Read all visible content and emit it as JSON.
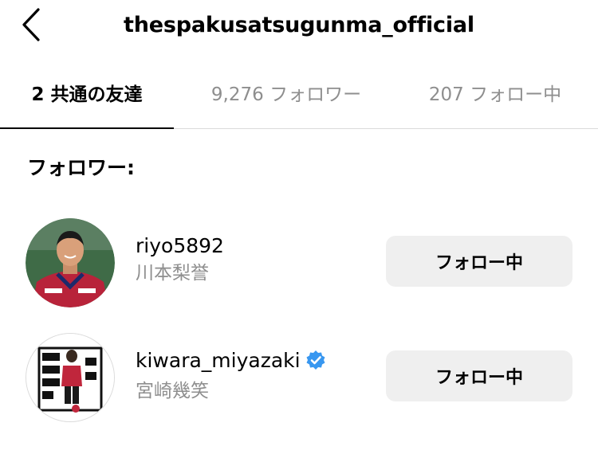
{
  "header": {
    "title": "thespakusatsugunma_official",
    "back_icon": "chevron-left-icon"
  },
  "tabs": [
    {
      "label": "2 共通の友達",
      "active": true
    },
    {
      "label": "9,276 フォロワー",
      "active": false
    },
    {
      "label": "207 フォロー中",
      "active": false
    }
  ],
  "section": {
    "label": "フォロワー:"
  },
  "users": [
    {
      "username": "riyo5892",
      "full_name": "川本梨誉",
      "verified": false,
      "button_label": "フォロー中"
    },
    {
      "username": "kiwara_miyazaki",
      "full_name": "宮崎幾笑",
      "verified": true,
      "button_label": "フォロー中"
    }
  ],
  "colors": {
    "accent_verified": "#3897f0",
    "muted_text": "#8e8e8e",
    "button_bg": "#efefef",
    "divider": "#dbdbdb"
  }
}
